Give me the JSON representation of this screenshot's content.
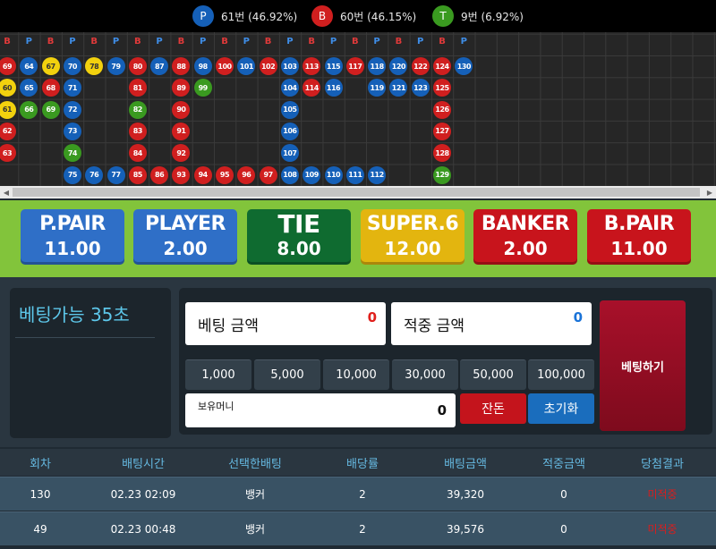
{
  "stats": [
    {
      "symbol": "P",
      "text": "61번 (46.92%)",
      "color": "#1560b8"
    },
    {
      "symbol": "B",
      "text": "60번 (46.15%)",
      "color": "#d01f1f"
    },
    {
      "symbol": "T",
      "text": "9번 (6.92%)",
      "color": "#3a9a20"
    }
  ],
  "grid": {
    "header_labels": [
      "B",
      "P",
      "B",
      "P",
      "B",
      "P",
      "B",
      "P",
      "B",
      "P",
      "B",
      "P",
      "B",
      "P",
      "B",
      "P",
      "B",
      "P",
      "B",
      "P",
      "B",
      "P"
    ],
    "rows": [
      [
        [
          "69",
          "B"
        ],
        [
          "64",
          "P"
        ],
        [
          "67",
          "S"
        ],
        [
          "70",
          "P"
        ],
        [
          "78",
          "S"
        ],
        [
          "79",
          "P"
        ],
        [
          "80",
          "B"
        ],
        [
          "87",
          "P"
        ],
        [
          "88",
          "B"
        ],
        [
          "98",
          "P"
        ],
        [
          "100",
          "B"
        ],
        [
          "101",
          "P"
        ],
        [
          "102",
          "B"
        ],
        [
          "103",
          "P"
        ],
        [
          "113",
          "B"
        ],
        [
          "115",
          "P"
        ],
        [
          "117",
          "B"
        ],
        [
          "118",
          "P"
        ],
        [
          "120",
          "P"
        ],
        [
          "122",
          "B"
        ],
        [
          "124",
          "B"
        ],
        [
          "130",
          "P"
        ]
      ],
      [
        [
          "60",
          "S"
        ],
        [
          "65",
          "P"
        ],
        [
          "68",
          "B"
        ],
        [
          "71",
          "P"
        ],
        null,
        null,
        [
          "81",
          "B"
        ],
        null,
        [
          "89",
          "B"
        ],
        [
          "99",
          "T"
        ],
        null,
        null,
        null,
        [
          "104",
          "P"
        ],
        [
          "114",
          "B"
        ],
        [
          "116",
          "P"
        ],
        null,
        [
          "119",
          "P"
        ],
        [
          "121",
          "P"
        ],
        [
          "123",
          "P"
        ],
        [
          "125",
          "B"
        ],
        null
      ],
      [
        [
          "61",
          "S"
        ],
        [
          "66",
          "T"
        ],
        [
          "69",
          "T"
        ],
        [
          "72",
          "P"
        ],
        null,
        null,
        [
          "82",
          "T"
        ],
        null,
        [
          "90",
          "B"
        ],
        null,
        null,
        null,
        null,
        [
          "105",
          "P"
        ],
        null,
        null,
        null,
        null,
        null,
        null,
        [
          "126",
          "B"
        ],
        null
      ],
      [
        [
          "62",
          "B"
        ],
        null,
        null,
        [
          "73",
          "P"
        ],
        null,
        null,
        [
          "83",
          "B"
        ],
        null,
        [
          "91",
          "B"
        ],
        null,
        null,
        null,
        null,
        [
          "106",
          "P"
        ],
        null,
        null,
        null,
        null,
        null,
        null,
        [
          "127",
          "B"
        ],
        null
      ],
      [
        [
          "63",
          "B"
        ],
        null,
        null,
        [
          "74",
          "T"
        ],
        null,
        null,
        [
          "84",
          "B"
        ],
        null,
        [
          "92",
          "B"
        ],
        null,
        null,
        null,
        null,
        [
          "107",
          "P"
        ],
        null,
        null,
        null,
        null,
        null,
        null,
        [
          "128",
          "B"
        ],
        null
      ],
      [
        null,
        null,
        null,
        [
          "75",
          "P"
        ],
        [
          "76",
          "P"
        ],
        [
          "77",
          "P"
        ],
        [
          "85",
          "B"
        ],
        [
          "86",
          "B"
        ],
        [
          "93",
          "B"
        ],
        [
          "94",
          "B"
        ],
        [
          "95",
          "B"
        ],
        [
          "96",
          "B"
        ],
        [
          "97",
          "B"
        ],
        [
          "108",
          "P"
        ],
        [
          "109",
          "P"
        ],
        [
          "110",
          "P"
        ],
        [
          "111",
          "P"
        ],
        [
          "112",
          "P"
        ],
        null,
        null,
        [
          "129",
          "T"
        ],
        null
      ]
    ]
  },
  "bets": [
    {
      "name": "P.PAIR",
      "value": "11.00",
      "color": "#2f6fc7"
    },
    {
      "name": "PLAYER",
      "value": "2.00",
      "color": "#2f6fc7"
    },
    {
      "name": "TIE",
      "value": "8.00",
      "color": "#0f6b30"
    },
    {
      "name": "SUPER.6",
      "value": "12.00",
      "color": "#e3b50f"
    },
    {
      "name": "BANKER",
      "value": "2.00",
      "color": "#c8141c"
    },
    {
      "name": "B.PAIR",
      "value": "11.00",
      "color": "#c8141c"
    }
  ],
  "timer_text": "베팅가능 35초",
  "bet_amount": {
    "label": "베팅 금액",
    "value": "0",
    "color": "#e0201c"
  },
  "win_amount": {
    "label": "적중 금액",
    "value": "0",
    "color": "#1a73d8"
  },
  "chips": [
    "1,000",
    "5,000",
    "10,000",
    "30,000",
    "50,000",
    "100,000"
  ],
  "balance": {
    "label": "보유머니",
    "value": "0"
  },
  "change_button": "잔돈",
  "reset_button": "초기화",
  "place_bet_button": "베팅하기",
  "table": {
    "headers": [
      "회차",
      "배팅시간",
      "선택한배팅",
      "배당률",
      "배팅금액",
      "적중금액",
      "당첨결과"
    ],
    "rows": [
      [
        "130",
        "02.23 02:09",
        "뱅커",
        "2",
        "39,320",
        "0",
        "미적중"
      ],
      [
        "49",
        "02.23 00:48",
        "뱅커",
        "2",
        "39,576",
        "0",
        "미적중"
      ]
    ]
  }
}
